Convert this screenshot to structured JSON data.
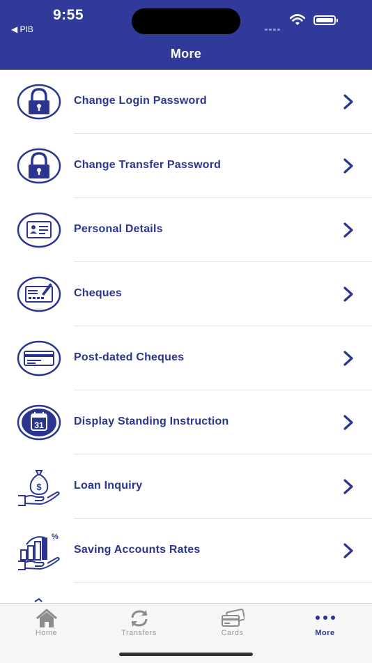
{
  "status_bar": {
    "time": "9:55",
    "back_app": "◀ PIB"
  },
  "header": {
    "title": "More"
  },
  "colors": {
    "brand": "#2f3a9a",
    "text_accent": "#2b3590",
    "tab_inactive": "#9a9a9a"
  },
  "menu": [
    {
      "label": "Change Login Password",
      "icon": "lock-icon"
    },
    {
      "label": "Change Transfer Password",
      "icon": "lock-icon"
    },
    {
      "label": "Personal Details",
      "icon": "id-card-icon"
    },
    {
      "label": "Cheques",
      "icon": "cheque-icon"
    },
    {
      "label": "Post-dated Cheques",
      "icon": "card-icon"
    },
    {
      "label": "Display Standing Instruction",
      "icon": "calendar-icon"
    },
    {
      "label": "Loan Inquiry",
      "icon": "money-bag-hand-icon"
    },
    {
      "label": "Saving Accounts Rates",
      "icon": "rates-chart-icon"
    },
    {
      "label": "",
      "icon": "partial-icon"
    }
  ],
  "tabs": [
    {
      "label": "Home",
      "icon": "home-icon"
    },
    {
      "label": "Transfers",
      "icon": "transfer-icon"
    },
    {
      "label": "Cards",
      "icon": "cards-icon"
    },
    {
      "label": "More",
      "icon": "more-dots-icon",
      "active": true
    }
  ]
}
